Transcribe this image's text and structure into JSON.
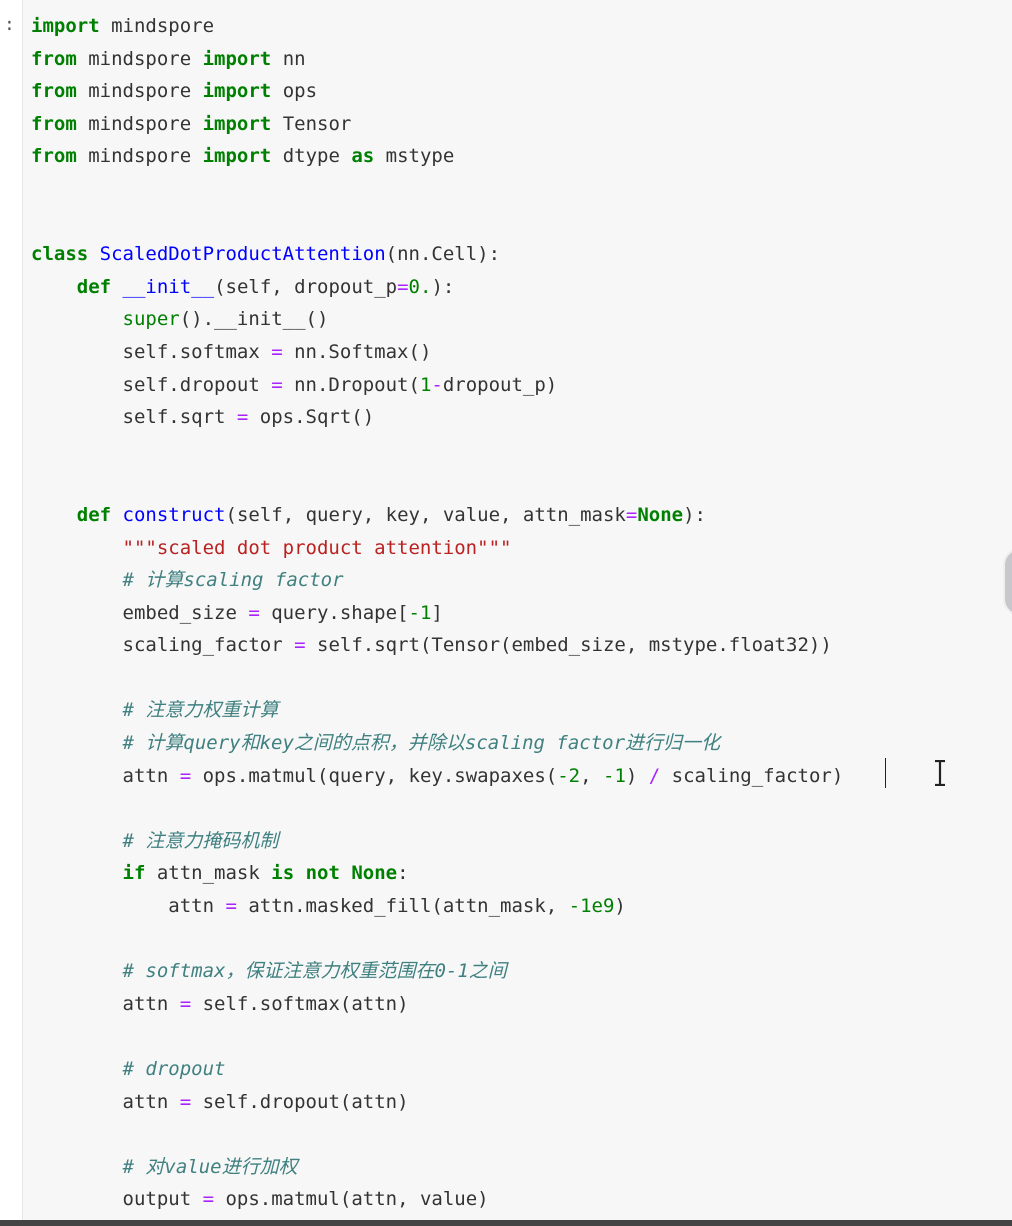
{
  "cell": {
    "prompt": ":"
  },
  "code_lines": [
    [
      {
        "t": "import",
        "c": "kw"
      },
      {
        "t": " mindspore",
        "c": "nm"
      }
    ],
    [
      {
        "t": "from",
        "c": "kw"
      },
      {
        "t": " mindspore ",
        "c": "nm"
      },
      {
        "t": "import",
        "c": "kw"
      },
      {
        "t": " nn",
        "c": "nm"
      }
    ],
    [
      {
        "t": "from",
        "c": "kw"
      },
      {
        "t": " mindspore ",
        "c": "nm"
      },
      {
        "t": "import",
        "c": "kw"
      },
      {
        "t": " ops",
        "c": "nm"
      }
    ],
    [
      {
        "t": "from",
        "c": "kw"
      },
      {
        "t": " mindspore ",
        "c": "nm"
      },
      {
        "t": "import",
        "c": "kw"
      },
      {
        "t": " Tensor",
        "c": "nm"
      }
    ],
    [
      {
        "t": "from",
        "c": "kw"
      },
      {
        "t": " mindspore ",
        "c": "nm"
      },
      {
        "t": "import",
        "c": "kw"
      },
      {
        "t": " dtype ",
        "c": "nm"
      },
      {
        "t": "as",
        "c": "kw"
      },
      {
        "t": " mstype",
        "c": "nm"
      }
    ],
    [],
    [],
    [
      {
        "t": "class",
        "c": "kw"
      },
      {
        "t": " ",
        "c": "nm"
      },
      {
        "t": "ScaledDotProductAttention",
        "c": "cls"
      },
      {
        "t": "(nn.Cell):",
        "c": "nm"
      }
    ],
    [
      {
        "t": "    ",
        "c": "nm"
      },
      {
        "t": "def",
        "c": "kw"
      },
      {
        "t": " ",
        "c": "nm"
      },
      {
        "t": "__init__",
        "c": "fn"
      },
      {
        "t": "(self, dropout_p",
        "c": "nm"
      },
      {
        "t": "=",
        "c": "op"
      },
      {
        "t": "0.",
        "c": "num"
      },
      {
        "t": "):",
        "c": "nm"
      }
    ],
    [
      {
        "t": "        ",
        "c": "nm"
      },
      {
        "t": "super",
        "c": "bi"
      },
      {
        "t": "().__init__()",
        "c": "nm"
      }
    ],
    [
      {
        "t": "        self.softmax ",
        "c": "nm"
      },
      {
        "t": "=",
        "c": "op"
      },
      {
        "t": " nn.Softmax()",
        "c": "nm"
      }
    ],
    [
      {
        "t": "        self.dropout ",
        "c": "nm"
      },
      {
        "t": "=",
        "c": "op"
      },
      {
        "t": " nn.Dropout(",
        "c": "nm"
      },
      {
        "t": "1",
        "c": "num"
      },
      {
        "t": "-",
        "c": "op"
      },
      {
        "t": "dropout_p)",
        "c": "nm"
      }
    ],
    [
      {
        "t": "        self.sqrt ",
        "c": "nm"
      },
      {
        "t": "=",
        "c": "op"
      },
      {
        "t": " ops.Sqrt()",
        "c": "nm"
      }
    ],
    [],
    [],
    [
      {
        "t": "    ",
        "c": "nm"
      },
      {
        "t": "def",
        "c": "kw"
      },
      {
        "t": " ",
        "c": "nm"
      },
      {
        "t": "construct",
        "c": "fn"
      },
      {
        "t": "(self, query, key, value, attn_mask",
        "c": "nm"
      },
      {
        "t": "=",
        "c": "op"
      },
      {
        "t": "None",
        "c": "kw"
      },
      {
        "t": "):",
        "c": "nm"
      }
    ],
    [
      {
        "t": "        ",
        "c": "nm"
      },
      {
        "t": "\"\"\"scaled dot product attention\"\"\"",
        "c": "str"
      }
    ],
    [
      {
        "t": "        ",
        "c": "nm"
      },
      {
        "t": "# 计算scaling factor",
        "c": "cm"
      }
    ],
    [
      {
        "t": "        embed_size ",
        "c": "nm"
      },
      {
        "t": "=",
        "c": "op"
      },
      {
        "t": " query.shape[",
        "c": "nm"
      },
      {
        "t": "-1",
        "c": "num"
      },
      {
        "t": "]",
        "c": "nm"
      }
    ],
    [
      {
        "t": "        scaling_factor ",
        "c": "nm"
      },
      {
        "t": "=",
        "c": "op"
      },
      {
        "t": " self.sqrt(Tensor(embed_size, mstype.float32))",
        "c": "nm"
      }
    ],
    [],
    [
      {
        "t": "        ",
        "c": "nm"
      },
      {
        "t": "# 注意力权重计算",
        "c": "cm"
      }
    ],
    [
      {
        "t": "        ",
        "c": "nm"
      },
      {
        "t": "# 计算query和key之间的点积，并除以scaling factor进行归一化",
        "c": "cm"
      }
    ],
    [
      {
        "t": "        attn ",
        "c": "nm"
      },
      {
        "t": "=",
        "c": "op"
      },
      {
        "t": " ops.matmul(query, key.swapaxes(",
        "c": "nm"
      },
      {
        "t": "-2",
        "c": "num"
      },
      {
        "t": ", ",
        "c": "nm"
      },
      {
        "t": "-1",
        "c": "num"
      },
      {
        "t": ") ",
        "c": "nm"
      },
      {
        "t": "/",
        "c": "op"
      },
      {
        "t": " scaling_factor)",
        "c": "nm"
      }
    ],
    [],
    [
      {
        "t": "        ",
        "c": "nm"
      },
      {
        "t": "# 注意力掩码机制",
        "c": "cm"
      }
    ],
    [
      {
        "t": "        ",
        "c": "nm"
      },
      {
        "t": "if",
        "c": "kw"
      },
      {
        "t": " attn_mask ",
        "c": "nm"
      },
      {
        "t": "is not",
        "c": "kw"
      },
      {
        "t": " ",
        "c": "nm"
      },
      {
        "t": "None",
        "c": "kw"
      },
      {
        "t": ":",
        "c": "nm"
      }
    ],
    [
      {
        "t": "            attn ",
        "c": "nm"
      },
      {
        "t": "=",
        "c": "op"
      },
      {
        "t": " attn.masked_fill(attn_mask, ",
        "c": "nm"
      },
      {
        "t": "-1e9",
        "c": "num"
      },
      {
        "t": ")",
        "c": "nm"
      }
    ],
    [],
    [
      {
        "t": "        ",
        "c": "nm"
      },
      {
        "t": "# softmax，保证注意力权重范围在0-1之间",
        "c": "cm"
      }
    ],
    [
      {
        "t": "        attn ",
        "c": "nm"
      },
      {
        "t": "=",
        "c": "op"
      },
      {
        "t": " self.softmax(attn)",
        "c": "nm"
      }
    ],
    [],
    [
      {
        "t": "        ",
        "c": "nm"
      },
      {
        "t": "# dropout",
        "c": "cm"
      }
    ],
    [
      {
        "t": "        attn ",
        "c": "nm"
      },
      {
        "t": "=",
        "c": "op"
      },
      {
        "t": " self.dropout(attn)",
        "c": "nm"
      }
    ],
    [],
    [
      {
        "t": "        ",
        "c": "nm"
      },
      {
        "t": "# 对value进行加权",
        "c": "cm"
      }
    ],
    [
      {
        "t": "        output ",
        "c": "nm"
      },
      {
        "t": "=",
        "c": "op"
      },
      {
        "t": " ops.matmul(attn, value)",
        "c": "nm"
      }
    ]
  ]
}
